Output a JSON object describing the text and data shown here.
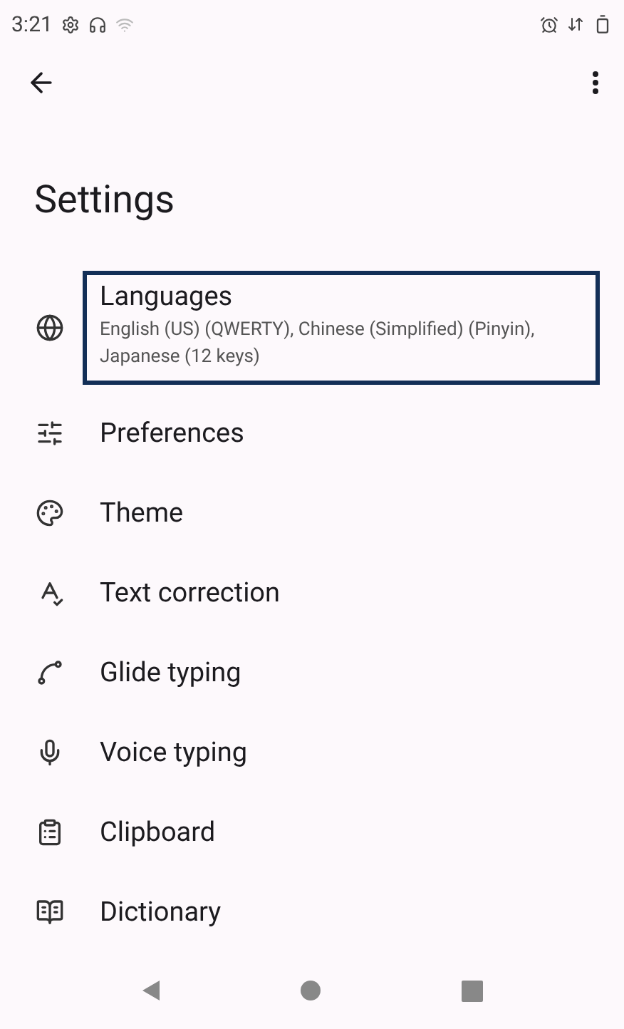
{
  "status_bar": {
    "time": "3:21"
  },
  "title": "Settings",
  "items": [
    {
      "label": "Languages",
      "summary": "English (US) (QWERTY), Chinese (Simplified) (Pinyin), Japanese (12 keys)",
      "highlighted": true
    },
    {
      "label": "Preferences",
      "highlighted": false
    },
    {
      "label": "Theme",
      "highlighted": false
    },
    {
      "label": "Text correction",
      "highlighted": false
    },
    {
      "label": "Glide typing",
      "highlighted": false
    },
    {
      "label": "Voice typing",
      "highlighted": false
    },
    {
      "label": "Clipboard",
      "highlighted": false
    },
    {
      "label": "Dictionary",
      "highlighted": false
    }
  ]
}
